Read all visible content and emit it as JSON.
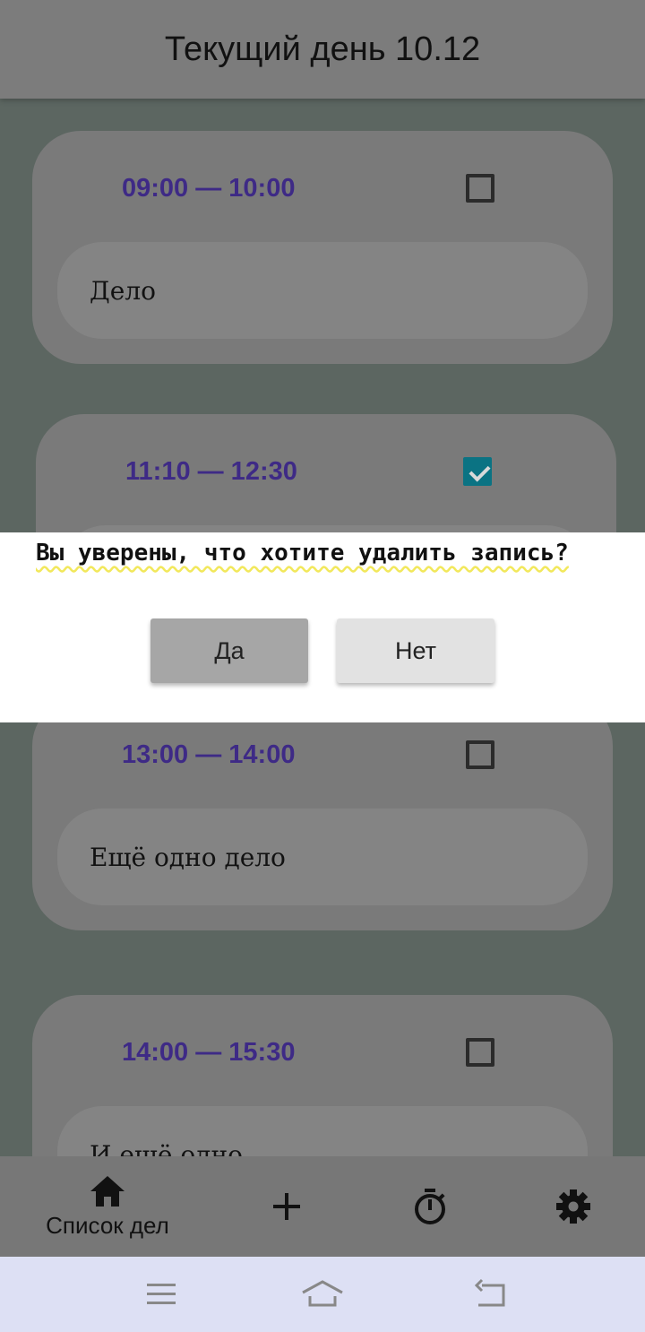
{
  "header": {
    "title": "Текущий день 10.12"
  },
  "tasks": [
    {
      "time": "09:00 — 10:00",
      "checked": false,
      "text": "Дело"
    },
    {
      "time": "11:10 — 12:30",
      "checked": true,
      "text": ""
    },
    {
      "time": "13:00 — 14:00",
      "checked": false,
      "text": "Ещё одно дело"
    },
    {
      "time": "14:00 — 15:30",
      "checked": false,
      "text": "И ещё одно"
    }
  ],
  "dialog": {
    "question": "Вы уверены, что хотите удалить запись?",
    "yes_label": "Да",
    "no_label": "Нет"
  },
  "bottom_nav": {
    "items": [
      {
        "icon": "home-icon",
        "label": "Список дел"
      },
      {
        "icon": "plus-icon"
      },
      {
        "icon": "timer-icon"
      },
      {
        "icon": "gear-icon"
      }
    ]
  },
  "system_nav": {
    "icons": [
      "menu-icon",
      "home-outline-icon",
      "back-icon"
    ]
  },
  "colors": {
    "time_text": "#3e2a86",
    "checkbox_checked": "#0b7383",
    "system_bar": "#dde0f4"
  }
}
